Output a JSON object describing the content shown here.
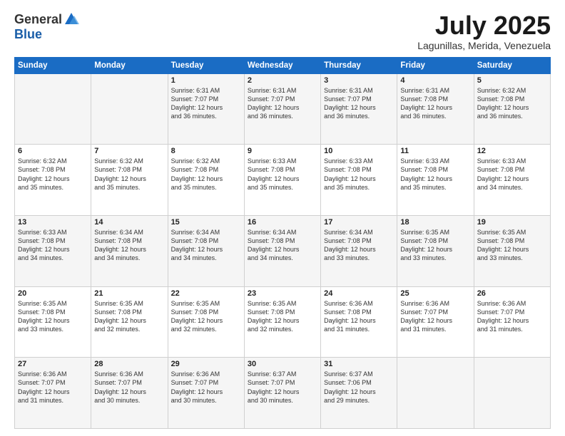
{
  "header": {
    "logo_general": "General",
    "logo_blue": "Blue",
    "month_title": "July 2025",
    "location": "Lagunillas, Merida, Venezuela"
  },
  "days_of_week": [
    "Sunday",
    "Monday",
    "Tuesday",
    "Wednesday",
    "Thursday",
    "Friday",
    "Saturday"
  ],
  "weeks": [
    [
      {
        "day": "",
        "info": ""
      },
      {
        "day": "",
        "info": ""
      },
      {
        "day": "1",
        "info": "Sunrise: 6:31 AM\nSunset: 7:07 PM\nDaylight: 12 hours\nand 36 minutes."
      },
      {
        "day": "2",
        "info": "Sunrise: 6:31 AM\nSunset: 7:07 PM\nDaylight: 12 hours\nand 36 minutes."
      },
      {
        "day": "3",
        "info": "Sunrise: 6:31 AM\nSunset: 7:07 PM\nDaylight: 12 hours\nand 36 minutes."
      },
      {
        "day": "4",
        "info": "Sunrise: 6:31 AM\nSunset: 7:08 PM\nDaylight: 12 hours\nand 36 minutes."
      },
      {
        "day": "5",
        "info": "Sunrise: 6:32 AM\nSunset: 7:08 PM\nDaylight: 12 hours\nand 36 minutes."
      }
    ],
    [
      {
        "day": "6",
        "info": "Sunrise: 6:32 AM\nSunset: 7:08 PM\nDaylight: 12 hours\nand 35 minutes."
      },
      {
        "day": "7",
        "info": "Sunrise: 6:32 AM\nSunset: 7:08 PM\nDaylight: 12 hours\nand 35 minutes."
      },
      {
        "day": "8",
        "info": "Sunrise: 6:32 AM\nSunset: 7:08 PM\nDaylight: 12 hours\nand 35 minutes."
      },
      {
        "day": "9",
        "info": "Sunrise: 6:33 AM\nSunset: 7:08 PM\nDaylight: 12 hours\nand 35 minutes."
      },
      {
        "day": "10",
        "info": "Sunrise: 6:33 AM\nSunset: 7:08 PM\nDaylight: 12 hours\nand 35 minutes."
      },
      {
        "day": "11",
        "info": "Sunrise: 6:33 AM\nSunset: 7:08 PM\nDaylight: 12 hours\nand 35 minutes."
      },
      {
        "day": "12",
        "info": "Sunrise: 6:33 AM\nSunset: 7:08 PM\nDaylight: 12 hours\nand 34 minutes."
      }
    ],
    [
      {
        "day": "13",
        "info": "Sunrise: 6:33 AM\nSunset: 7:08 PM\nDaylight: 12 hours\nand 34 minutes."
      },
      {
        "day": "14",
        "info": "Sunrise: 6:34 AM\nSunset: 7:08 PM\nDaylight: 12 hours\nand 34 minutes."
      },
      {
        "day": "15",
        "info": "Sunrise: 6:34 AM\nSunset: 7:08 PM\nDaylight: 12 hours\nand 34 minutes."
      },
      {
        "day": "16",
        "info": "Sunrise: 6:34 AM\nSunset: 7:08 PM\nDaylight: 12 hours\nand 34 minutes."
      },
      {
        "day": "17",
        "info": "Sunrise: 6:34 AM\nSunset: 7:08 PM\nDaylight: 12 hours\nand 33 minutes."
      },
      {
        "day": "18",
        "info": "Sunrise: 6:35 AM\nSunset: 7:08 PM\nDaylight: 12 hours\nand 33 minutes."
      },
      {
        "day": "19",
        "info": "Sunrise: 6:35 AM\nSunset: 7:08 PM\nDaylight: 12 hours\nand 33 minutes."
      }
    ],
    [
      {
        "day": "20",
        "info": "Sunrise: 6:35 AM\nSunset: 7:08 PM\nDaylight: 12 hours\nand 33 minutes."
      },
      {
        "day": "21",
        "info": "Sunrise: 6:35 AM\nSunset: 7:08 PM\nDaylight: 12 hours\nand 32 minutes."
      },
      {
        "day": "22",
        "info": "Sunrise: 6:35 AM\nSunset: 7:08 PM\nDaylight: 12 hours\nand 32 minutes."
      },
      {
        "day": "23",
        "info": "Sunrise: 6:35 AM\nSunset: 7:08 PM\nDaylight: 12 hours\nand 32 minutes."
      },
      {
        "day": "24",
        "info": "Sunrise: 6:36 AM\nSunset: 7:08 PM\nDaylight: 12 hours\nand 31 minutes."
      },
      {
        "day": "25",
        "info": "Sunrise: 6:36 AM\nSunset: 7:07 PM\nDaylight: 12 hours\nand 31 minutes."
      },
      {
        "day": "26",
        "info": "Sunrise: 6:36 AM\nSunset: 7:07 PM\nDaylight: 12 hours\nand 31 minutes."
      }
    ],
    [
      {
        "day": "27",
        "info": "Sunrise: 6:36 AM\nSunset: 7:07 PM\nDaylight: 12 hours\nand 31 minutes."
      },
      {
        "day": "28",
        "info": "Sunrise: 6:36 AM\nSunset: 7:07 PM\nDaylight: 12 hours\nand 30 minutes."
      },
      {
        "day": "29",
        "info": "Sunrise: 6:36 AM\nSunset: 7:07 PM\nDaylight: 12 hours\nand 30 minutes."
      },
      {
        "day": "30",
        "info": "Sunrise: 6:37 AM\nSunset: 7:07 PM\nDaylight: 12 hours\nand 30 minutes."
      },
      {
        "day": "31",
        "info": "Sunrise: 6:37 AM\nSunset: 7:06 PM\nDaylight: 12 hours\nand 29 minutes."
      },
      {
        "day": "",
        "info": ""
      },
      {
        "day": "",
        "info": ""
      }
    ]
  ]
}
